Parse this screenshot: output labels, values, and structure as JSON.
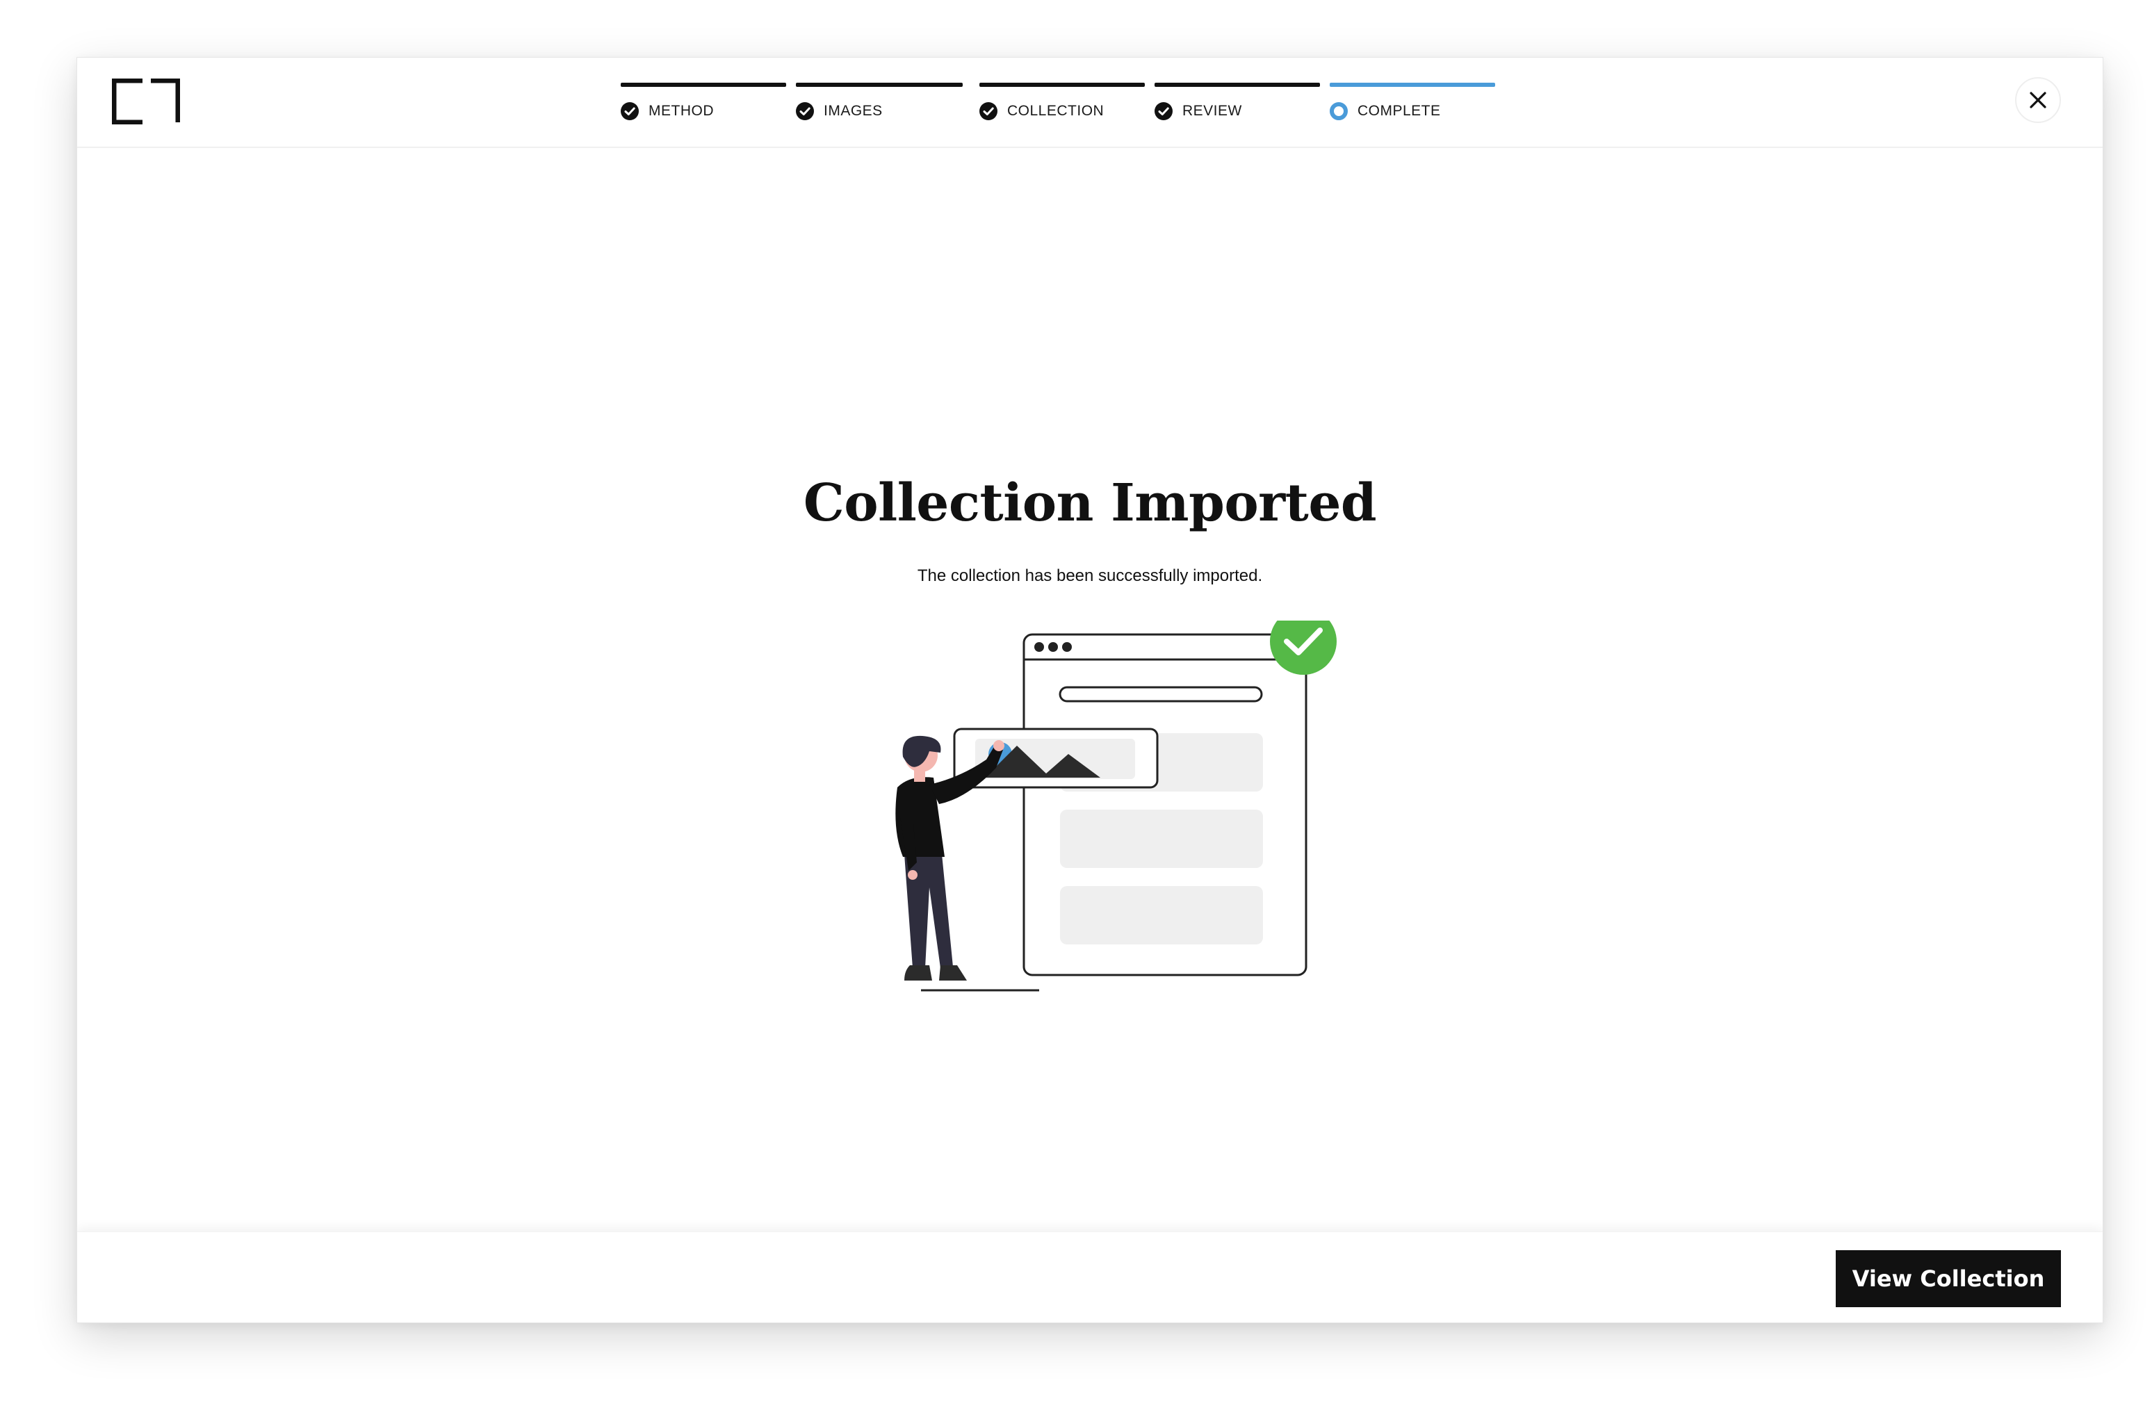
{
  "steps": [
    {
      "label": "METHOD",
      "status": "done"
    },
    {
      "label": "IMAGES",
      "status": "done"
    },
    {
      "label": "COLLECTION",
      "status": "done"
    },
    {
      "label": "REVIEW",
      "status": "done"
    },
    {
      "label": "COMPLETE",
      "status": "active"
    }
  ],
  "main": {
    "title": "Collection Imported",
    "subtitle": "The collection has been successfully imported."
  },
  "footer": {
    "primary_button_label": "View Collection"
  },
  "icons": {
    "logo": "brand-logo-icon",
    "close": "close-icon",
    "step_done": "check-circle-icon",
    "step_active": "radio-active-icon",
    "success": "success-check-icon"
  },
  "colors": {
    "accent": "#4a9bd9",
    "success": "#55b947",
    "primary": "#111111"
  }
}
